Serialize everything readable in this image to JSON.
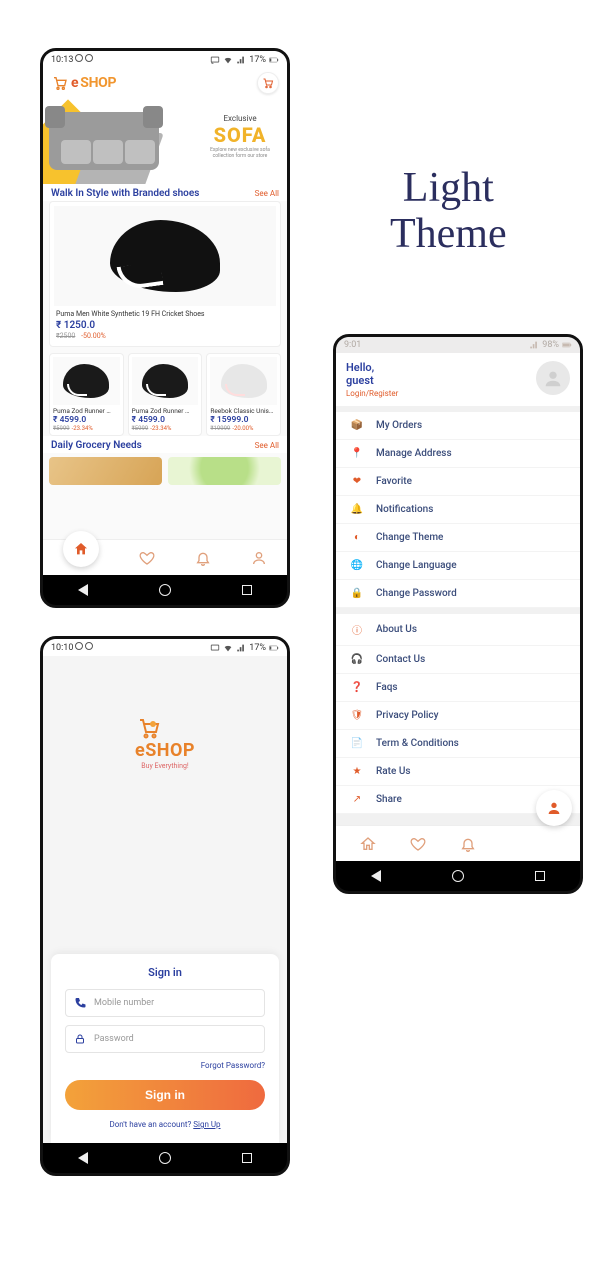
{
  "page_title": {
    "line1": "Light",
    "line2": "Theme"
  },
  "p1": {
    "status": {
      "time": "10:13",
      "battery": "17%"
    },
    "brand": {
      "e": "e",
      "shop": "SHOP"
    },
    "banner": {
      "eyebrow": "Exclusive",
      "headline": "SOFA",
      "sub": "Explore new exclusive sofa collection form our store"
    },
    "sect1": {
      "title": "Walk In Style with Branded shoes",
      "see_all": "See All"
    },
    "big": {
      "name": "Puma Men White Synthetic 19 FH Cricket Shoes",
      "price": "₹ 1250.0",
      "old": "₹2500",
      "disc": "-50.00%"
    },
    "row": [
      {
        "name": "Puma Zod Runner …",
        "price": "₹ 4599.0",
        "old": "₹5999",
        "disc": "-23.34%"
      },
      {
        "name": "Puma Zod Runner …",
        "price": "₹ 4599.0",
        "old": "₹5999",
        "disc": "-23.34%"
      },
      {
        "name": "Reebok Classic Unis…",
        "price": "₹ 15999.0",
        "old": "₹19999",
        "disc": "-20.00%"
      }
    ],
    "sect2": {
      "title": "Daily Grocery Needs",
      "see_all": "See All"
    }
  },
  "p2": {
    "status": {
      "time": "10:10",
      "battery": "17%"
    },
    "brand": {
      "name": "eSHOP",
      "tag": "Buy Everything!"
    },
    "card": {
      "title": "Sign in",
      "mobile_ph": "Mobile number",
      "password_ph": "Password",
      "forgot": "Forgot Password?",
      "button": "Sign in",
      "noacc_pre": "Don't have an account? ",
      "signup": "Sign Up"
    }
  },
  "p3": {
    "status": {
      "time": "9:01",
      "battery": "98%"
    },
    "hdr": {
      "hello": "Hello,",
      "guest": "guest",
      "login": "Login/Register"
    },
    "group1": [
      {
        "icon": "orders-icon",
        "glyph": "📦",
        "label": "My Orders"
      },
      {
        "icon": "address-icon",
        "glyph": "📍",
        "label": "Manage Address"
      },
      {
        "icon": "favorite-icon",
        "glyph": "❤",
        "label": "Favorite"
      },
      {
        "icon": "notifications-icon",
        "glyph": "🔔",
        "label": "Notifications"
      },
      {
        "icon": "theme-icon",
        "glyph": "◐",
        "label": "Change Theme"
      },
      {
        "icon": "language-icon",
        "glyph": "🌐",
        "label": "Change Language"
      },
      {
        "icon": "password-icon",
        "glyph": "🔒",
        "label": "Change Password"
      }
    ],
    "group2": [
      {
        "icon": "about-icon",
        "glyph": "ⓘ",
        "label": "About Us"
      },
      {
        "icon": "contact-icon",
        "glyph": "🎧",
        "label": "Contact Us"
      },
      {
        "icon": "faqs-icon",
        "glyph": "❓",
        "label": "Faqs"
      },
      {
        "icon": "privacy-icon",
        "glyph": "🛡",
        "label": "Privacy Policy"
      },
      {
        "icon": "terms-icon",
        "glyph": "📄",
        "label": "Term & Conditions"
      },
      {
        "icon": "rate-icon",
        "glyph": "★",
        "label": "Rate Us"
      },
      {
        "icon": "share-icon",
        "glyph": "↗",
        "label": "Share"
      }
    ]
  }
}
